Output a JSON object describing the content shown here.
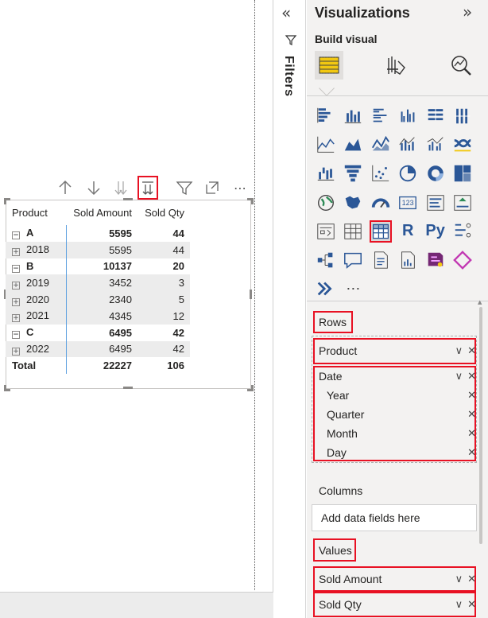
{
  "toolbar": {
    "icons": [
      "arrow-up-icon",
      "arrow-down-icon",
      "double-arrow-down-icon",
      "expand-all-down-icon",
      "filter-icon",
      "focus-mode-icon",
      "more-options-icon"
    ],
    "more_label": "⋯"
  },
  "matrix": {
    "headers": [
      "Product",
      "Sold Amount",
      "Sold Qty"
    ],
    "rows": [
      {
        "label": "A",
        "amount": "5595",
        "qty": "44",
        "level": 0
      },
      {
        "label": "2018",
        "amount": "5595",
        "qty": "44",
        "level": 1
      },
      {
        "label": "B",
        "amount": "10137",
        "qty": "20",
        "level": 0
      },
      {
        "label": "2019",
        "amount": "3452",
        "qty": "3",
        "level": 1
      },
      {
        "label": "2020",
        "amount": "2340",
        "qty": "5",
        "level": 1
      },
      {
        "label": "2021",
        "amount": "4345",
        "qty": "12",
        "level": 1
      },
      {
        "label": "C",
        "amount": "6495",
        "qty": "42",
        "level": 0
      },
      {
        "label": "2022",
        "amount": "6495",
        "qty": "42",
        "level": 1
      }
    ],
    "total": {
      "label": "Total",
      "amount": "22227",
      "qty": "106"
    }
  },
  "filters": {
    "label": "Filters",
    "collapse_glyph": "«"
  },
  "pane": {
    "title": "Visualizations",
    "expand_glyph": "»",
    "build_label": "Build visual",
    "more_visuals_glyph": "⋯",
    "r_label": "R",
    "py_label": "Py",
    "num_label": "123"
  },
  "wells": {
    "rows_label": "Rows",
    "rows_fields": [
      {
        "name": "Product"
      },
      {
        "name": "Date"
      },
      {
        "name": "Year"
      },
      {
        "name": "Quarter"
      },
      {
        "name": "Month"
      },
      {
        "name": "Day"
      }
    ],
    "columns_label": "Columns",
    "columns_placeholder": "Add data fields here",
    "values_label": "Values",
    "values_fields": [
      {
        "name": "Sold Amount"
      },
      {
        "name": "Sold Qty"
      }
    ],
    "chevron_glyph": "∨",
    "remove_glyph": "✕"
  },
  "colors": {
    "highlight_red": "#e81123",
    "accent_yellow": "#f2c811",
    "icon_blue": "#2b5797"
  }
}
